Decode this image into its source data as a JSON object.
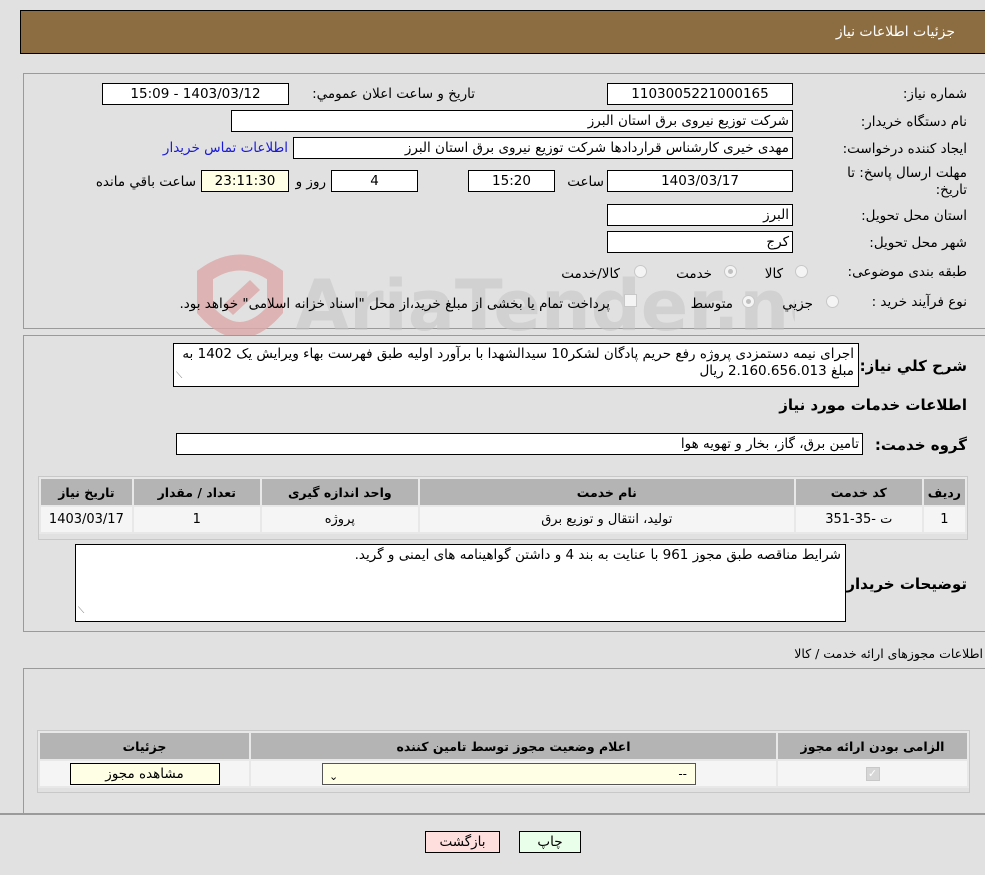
{
  "header": {
    "title": "جزئیات اطلاعات نیاز"
  },
  "form": {
    "need_number": {
      "label": "شماره نیاز:",
      "value": "1103005221000165"
    },
    "announce_datetime": {
      "label": "تاریخ و ساعت اعلان عمومي:",
      "value": "1403/03/12 - 15:09"
    },
    "buyer_org": {
      "label": "نام دستگاه خريدار:",
      "value": "شرکت توزیع نیروی برق استان البرز"
    },
    "requester": {
      "label": "ايجاد کننده درخواست:",
      "value": "مهدی خیری کارشناس قراردادها شرکت توزیع نیروی برق استان البرز"
    },
    "buyer_contact_link": "اطلاعات تماس خريدار",
    "deadline": {
      "label": "مهلت ارسال پاسخ: تا تاریخ:",
      "date": "1403/03/17",
      "time_label": "ساعت",
      "time": "15:20",
      "days": "4",
      "days_label": "روز و",
      "remaining": "23:11:30",
      "remaining_label": "ساعت باقي مانده"
    },
    "delivery_province": {
      "label": "استان محل تحویل:",
      "value": "البرز"
    },
    "delivery_city": {
      "label": "شهر محل تحویل:",
      "value": "کرج"
    },
    "category": {
      "label": "طبقه بندی موضوعی:",
      "options": [
        "کالا",
        "خدمت",
        "کالا/خدمت"
      ],
      "selected": "خدمت"
    },
    "purchase_process": {
      "label": "نوع فرآیند خرید :",
      "options": [
        "جزيي",
        "متوسط"
      ],
      "selected": "متوسط",
      "treasury_note": "پرداخت تمام یا بخشی از مبلغ خرید،از محل \"اسناد خزانه اسلامی\" خواهد بود."
    }
  },
  "description": {
    "label": "شرح کلي نياز:",
    "value": "اجرای نیمه دستمزدی پروژه رفع حریم پادگان لشکر10 سیدالشهدا با برآورد اولیه طبق فهرست بهاء ویرایش یک 1402 به مبلغ 2.160.656.013 ریال"
  },
  "services_section": {
    "title": "اطلاعات خدمات مورد نياز",
    "group_label": "گروه خدمت:",
    "group_value": "تامین برق، گاز، بخار و تهویه هوا",
    "table": {
      "headers": [
        "رديف",
        "کد خدمت",
        "نام خدمت",
        "واحد اندازه گیری",
        "تعداد / مقدار",
        "تاریخ نیاز"
      ],
      "rows": [
        [
          "1",
          "ت -35-351",
          "تولید، انتقال و توزیع برق",
          "پروژه",
          "1",
          "1403/03/17"
        ]
      ]
    }
  },
  "buyer_notes": {
    "label": "توضيحات خريدار:",
    "value": "شرایط مناقصه طبق مجوز 961 با عنایت به بند 4 و داشتن گواهینامه های ایمنی و گرید."
  },
  "licenses": {
    "title": "اطلاعات مجوزهای ارائه خدمت / کالا",
    "headers": [
      "الزامی بودن ارائه مجوز",
      "اعلام وضعیت مجوز توسط تامین کننده",
      "جزئیات"
    ],
    "row": {
      "required_checked": true,
      "status_value": "--",
      "view_button": "مشاهده مجوز"
    }
  },
  "footer": {
    "print_button": "چاپ",
    "back_button": "بازگشت"
  },
  "watermark": {
    "text": "AriaTender.neT"
  }
}
